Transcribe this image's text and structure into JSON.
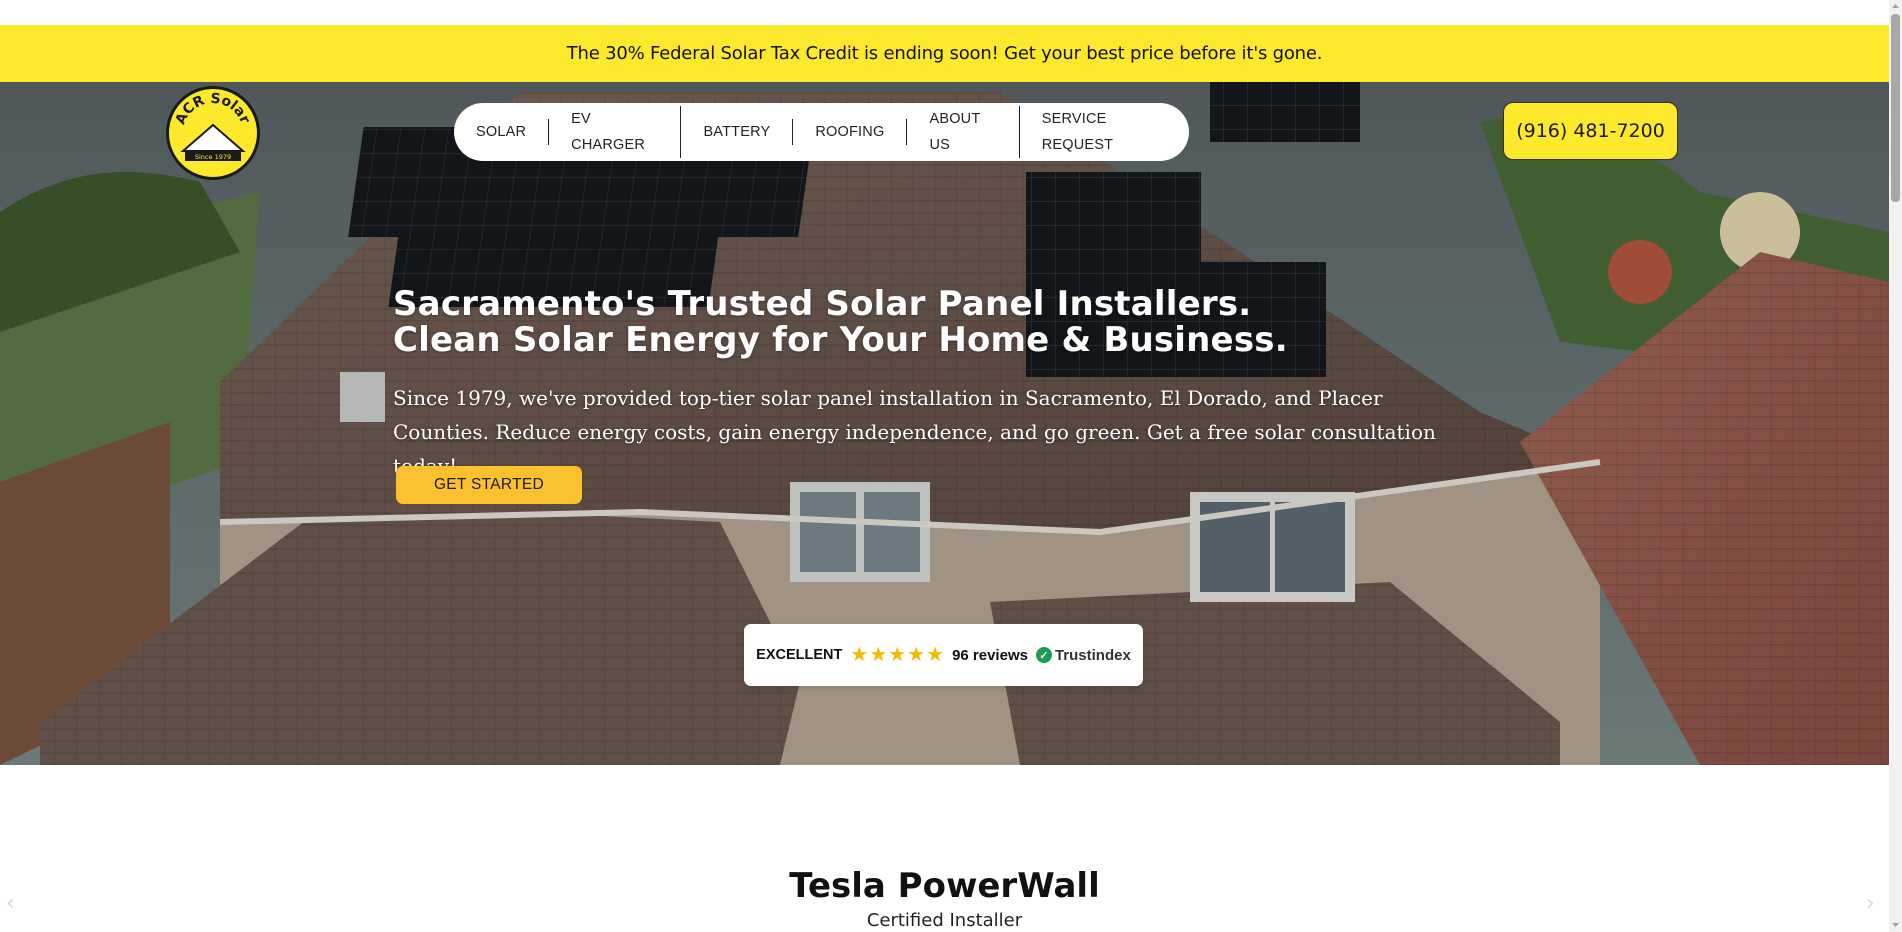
{
  "promo": {
    "text": "The 30% Federal Solar Tax Credit is ending soon! Get your best price before it's gone."
  },
  "logo": {
    "brand": "ACR Solar",
    "since": "Since 1979"
  },
  "nav": {
    "items": [
      {
        "label": "SOLAR"
      },
      {
        "label": "EV CHARGER"
      },
      {
        "label": "BATTERY"
      },
      {
        "label": "ROOFING"
      },
      {
        "label": "ABOUT US"
      },
      {
        "label": "SERVICE REQUEST"
      }
    ]
  },
  "header": {
    "phone": "(916) 481-7200"
  },
  "hero": {
    "headline_line1": "Sacramento's Trusted Solar Panel Installers.",
    "headline_line2": "Clean Solar Energy for Your Home & Business.",
    "subtext": "Since 1979, we've provided top-tier solar panel installation in Sacramento, El Dorado, and Placer Counties. Reduce energy costs, gain energy independence, and go green. Get a free solar consultation today!",
    "cta_label": "GET STARTED"
  },
  "reviews": {
    "rating_label": "EXCELLENT",
    "stars": 5,
    "count_label": "96 reviews",
    "provider": "Trustindex"
  },
  "section": {
    "title": "Tesla PowerWall",
    "subtitle": "Certified Installer"
  },
  "carousel": {
    "prev_icon": "chevron-left-icon",
    "next_icon": "chevron-right-icon"
  },
  "colors": {
    "accent_yellow": "#fde92b",
    "cta_yellow": "#fbc02d",
    "star": "#f6b900",
    "trust_green": "#1d9b52"
  }
}
